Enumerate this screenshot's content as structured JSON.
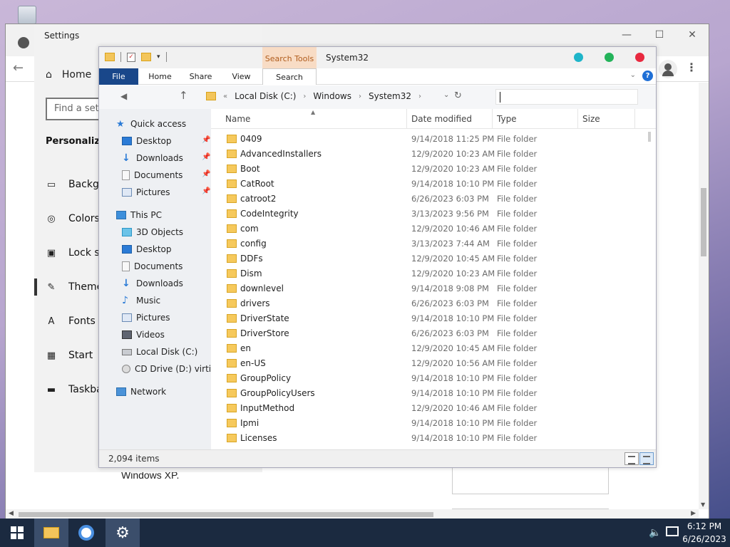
{
  "settings": {
    "title": "Settings",
    "home_label": "Home",
    "find_placeholder": "Find a setting",
    "section": "Personalization",
    "nav": [
      {
        "label": "Background",
        "icon": "image-icon"
      },
      {
        "label": "Colors",
        "icon": "palette-icon"
      },
      {
        "label": "Lock screen",
        "icon": "lock-screen-icon"
      },
      {
        "label": "Themes",
        "icon": "themes-icon"
      },
      {
        "label": "Fonts",
        "icon": "fonts-icon"
      },
      {
        "label": "Start",
        "icon": "start-icon"
      },
      {
        "label": "Taskbar",
        "icon": "taskbar-icon"
      }
    ]
  },
  "browser": {
    "bullet1": "Start Buttons no longer have fade transition and are accurate to Windows XP."
  },
  "explorer": {
    "title": "System32",
    "search_tools_tab": "Search Tools",
    "ribbon_tabs": [
      "File",
      "Home",
      "Share",
      "View",
      "Search"
    ],
    "breadcrumb": [
      "Local Disk (C:)",
      "Windows",
      "System32"
    ],
    "columns": [
      "Name",
      "Date modified",
      "Type",
      "Size"
    ],
    "status": "2,094 items",
    "accent_colors": {
      "file_tab": "#19478a",
      "search_tools": "#f8dcc5",
      "dot1": "#1fb5c9",
      "dot2": "#24b35a",
      "dot3": "#e8293f"
    },
    "nav_tree": [
      {
        "label": "Quick access",
        "icon": "star-icon",
        "level": 0,
        "pinned": false
      },
      {
        "label": "Desktop",
        "icon": "desktop-icon",
        "level": 1,
        "pinned": true
      },
      {
        "label": "Downloads",
        "icon": "downloads-icon",
        "level": 1,
        "pinned": true
      },
      {
        "label": "Documents",
        "icon": "documents-icon",
        "level": 1,
        "pinned": true
      },
      {
        "label": "Pictures",
        "icon": "pictures-icon",
        "level": 1,
        "pinned": true
      },
      {
        "label": "This PC",
        "icon": "this-pc-icon",
        "level": 0,
        "pinned": false
      },
      {
        "label": "3D Objects",
        "icon": "3d-objects-icon",
        "level": 1,
        "pinned": false
      },
      {
        "label": "Desktop",
        "icon": "desktop-icon",
        "level": 1,
        "pinned": false
      },
      {
        "label": "Documents",
        "icon": "documents-icon",
        "level": 1,
        "pinned": false
      },
      {
        "label": "Downloads",
        "icon": "downloads-icon",
        "level": 1,
        "pinned": false
      },
      {
        "label": "Music",
        "icon": "music-icon",
        "level": 1,
        "pinned": false
      },
      {
        "label": "Pictures",
        "icon": "pictures-icon",
        "level": 1,
        "pinned": false
      },
      {
        "label": "Videos",
        "icon": "videos-icon",
        "level": 1,
        "pinned": false
      },
      {
        "label": "Local Disk (C:)",
        "icon": "disk-icon",
        "level": 1,
        "pinned": false
      },
      {
        "label": "CD Drive (D:) virtio-",
        "icon": "cd-icon",
        "level": 1,
        "pinned": false
      },
      {
        "label": "Network",
        "icon": "network-icon",
        "level": 0,
        "pinned": false
      }
    ],
    "files": [
      {
        "name": "0409",
        "date": "9/14/2018 11:25 PM",
        "type": "File folder"
      },
      {
        "name": "AdvancedInstallers",
        "date": "12/9/2020 10:23 AM",
        "type": "File folder"
      },
      {
        "name": "Boot",
        "date": "12/9/2020 10:23 AM",
        "type": "File folder"
      },
      {
        "name": "CatRoot",
        "date": "9/14/2018 10:10 PM",
        "type": "File folder"
      },
      {
        "name": "catroot2",
        "date": "6/26/2023 6:03 PM",
        "type": "File folder"
      },
      {
        "name": "CodeIntegrity",
        "date": "3/13/2023 9:56 PM",
        "type": "File folder"
      },
      {
        "name": "com",
        "date": "12/9/2020 10:46 AM",
        "type": "File folder"
      },
      {
        "name": "config",
        "date": "3/13/2023 7:44 AM",
        "type": "File folder"
      },
      {
        "name": "DDFs",
        "date": "12/9/2020 10:45 AM",
        "type": "File folder"
      },
      {
        "name": "Dism",
        "date": "12/9/2020 10:23 AM",
        "type": "File folder"
      },
      {
        "name": "downlevel",
        "date": "9/14/2018 9:08 PM",
        "type": "File folder"
      },
      {
        "name": "drivers",
        "date": "6/26/2023 6:03 PM",
        "type": "File folder"
      },
      {
        "name": "DriverState",
        "date": "9/14/2018 10:10 PM",
        "type": "File folder"
      },
      {
        "name": "DriverStore",
        "date": "6/26/2023 6:03 PM",
        "type": "File folder"
      },
      {
        "name": "en",
        "date": "12/9/2020 10:45 AM",
        "type": "File folder"
      },
      {
        "name": "en-US",
        "date": "12/9/2020 10:56 AM",
        "type": "File folder"
      },
      {
        "name": "GroupPolicy",
        "date": "9/14/2018 10:10 PM",
        "type": "File folder"
      },
      {
        "name": "GroupPolicyUsers",
        "date": "9/14/2018 10:10 PM",
        "type": "File folder"
      },
      {
        "name": "InputMethod",
        "date": "12/9/2020 10:46 AM",
        "type": "File folder"
      },
      {
        "name": "Ipmi",
        "date": "9/14/2018 10:10 PM",
        "type": "File folder"
      },
      {
        "name": "Licenses",
        "date": "9/14/2018 10:10 PM",
        "type": "File folder"
      }
    ]
  },
  "taskbar": {
    "time": "6:12 PM",
    "date": "6/26/2023",
    "apps": [
      "start-icon",
      "file-explorer-icon",
      "chrome-icon",
      "settings-gear-icon"
    ]
  }
}
